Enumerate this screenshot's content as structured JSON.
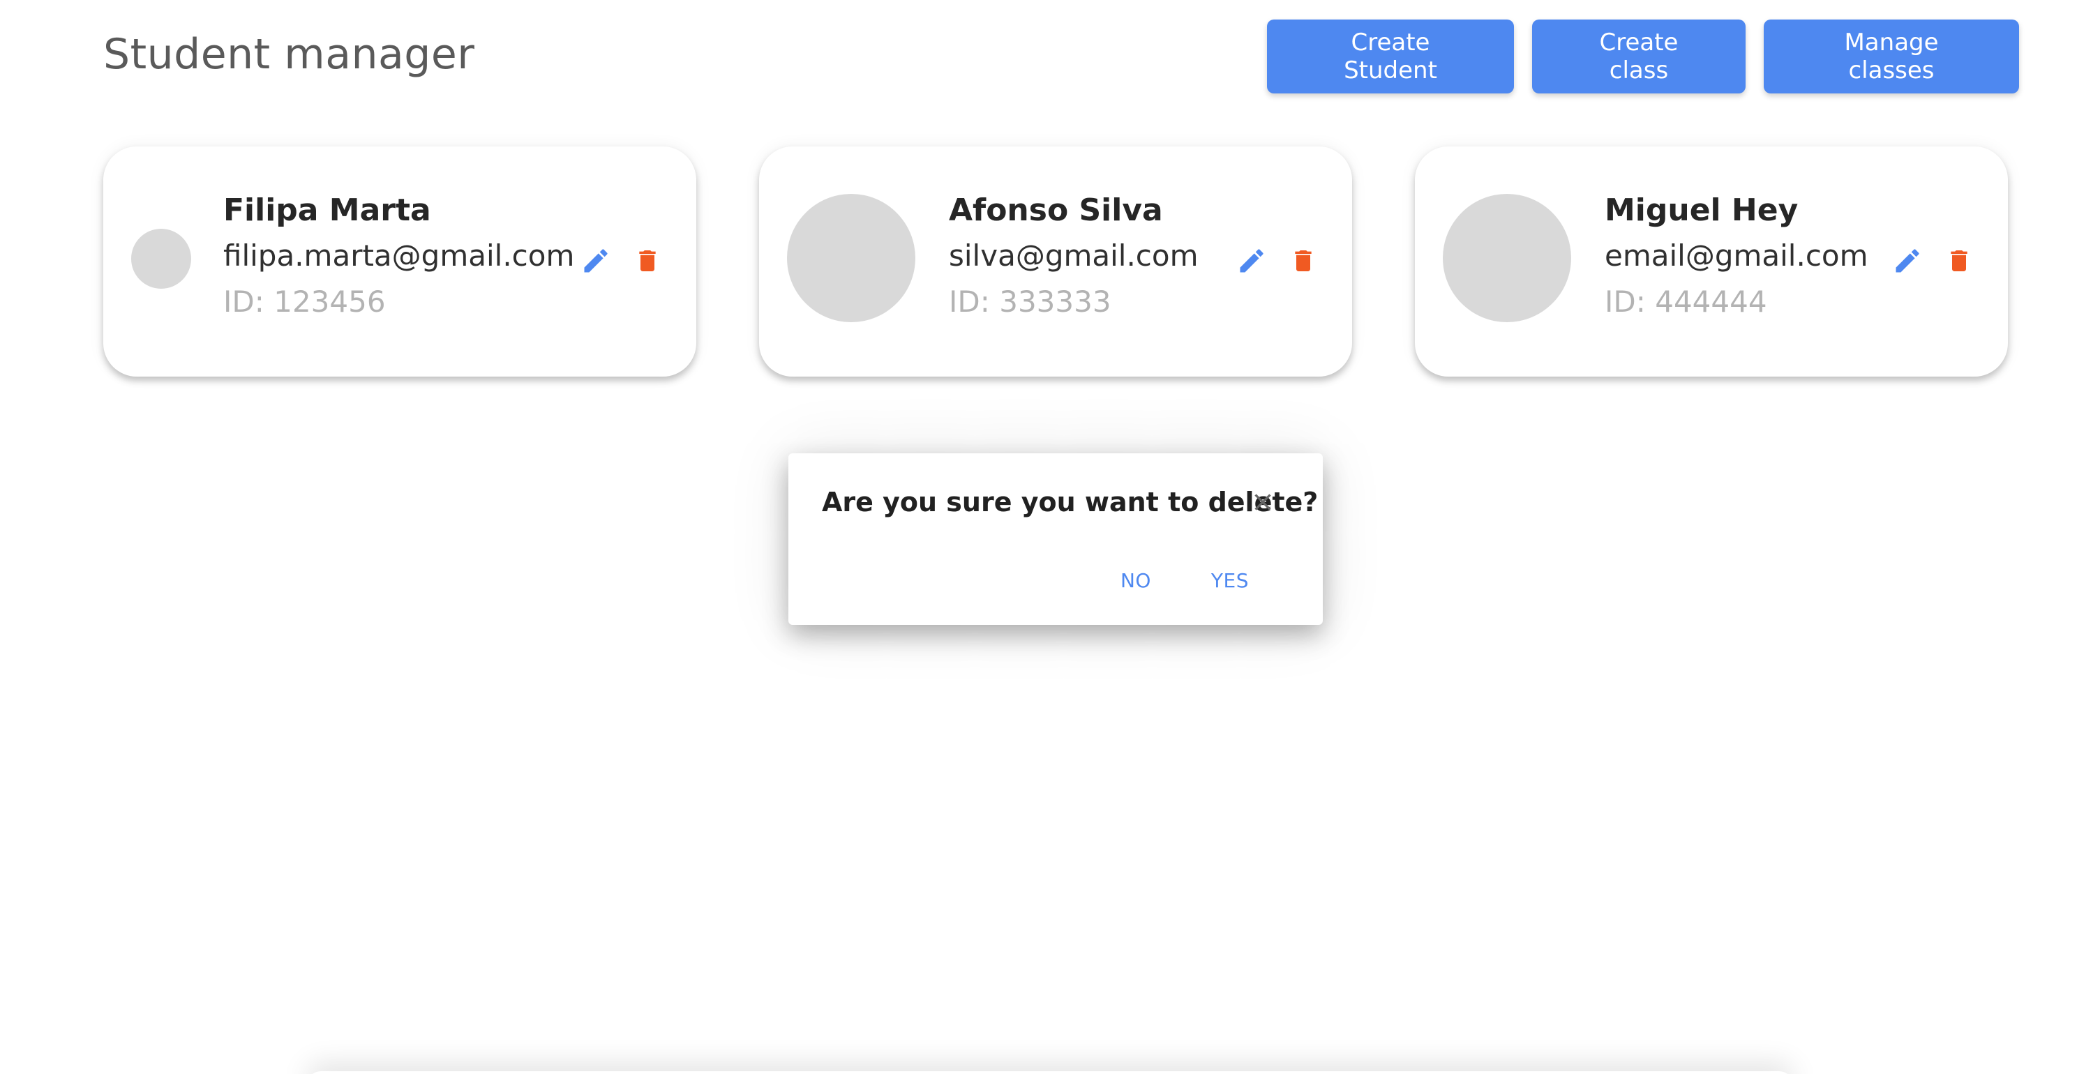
{
  "header": {
    "title": "Student manager",
    "buttons": {
      "create_student": "Create Student",
      "create_class": "Create class",
      "manage_classes": "Manage classes"
    }
  },
  "students": [
    {
      "name": "Filipa Marta",
      "email": "filipa.marta@gmail.com",
      "id_label": "ID: 123456"
    },
    {
      "name": "Afonso Silva",
      "email": "silva@gmail.com",
      "id_label": "ID: 333333"
    },
    {
      "name": "Miguel Hey",
      "email": "email@gmail.com",
      "id_label": "ID: 444444"
    }
  ],
  "dialog": {
    "message": "Are you sure you want to delete?",
    "no_label": "NO",
    "yes_label": "YES"
  },
  "icons": {
    "edit": "pencil-icon",
    "delete": "trash-icon",
    "close": "close-icon"
  },
  "colors": {
    "primary": "#4e88f0",
    "danger": "#f05a22",
    "avatar": "#d9d9d9"
  }
}
